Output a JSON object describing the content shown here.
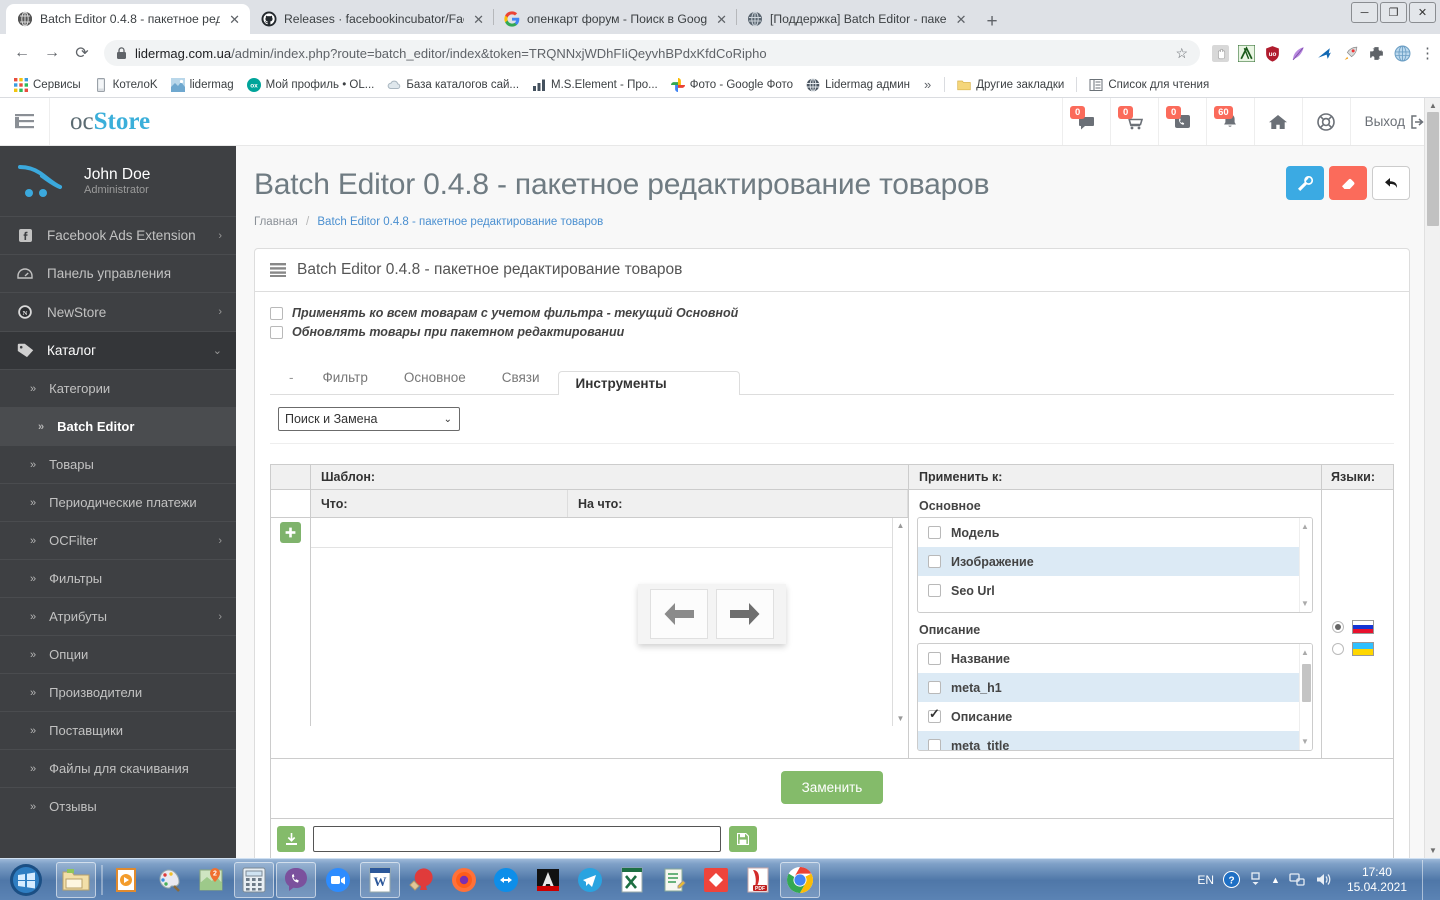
{
  "browser": {
    "tabs": [
      {
        "title": "Batch Editor 0.4.8 - пакетное ред",
        "icon": "globe-blue",
        "active": true
      },
      {
        "title": "Releases · facebookincubator/Fac",
        "icon": "github",
        "active": false
      },
      {
        "title": "опенкарт форум - Поиск в Goog",
        "icon": "google",
        "active": false
      },
      {
        "title": "[Поддержка] Batch Editor - паке",
        "icon": "globe-grey",
        "active": false
      }
    ],
    "new_tab_label": "+",
    "window_controls": {
      "minimize": "─",
      "maximize": "❐",
      "close": "✕"
    },
    "nav": {
      "back": "←",
      "forward": "→",
      "reload": "⟳"
    },
    "url_host": "lidermag.com.ua",
    "url_path": "/admin/index.php?route=batch_editor/index&token=TRQNNxjWDhFIiQeyvhBPdxKfdCoRipho",
    "star_icon": "☆",
    "extension_icons": [
      "hand-icon",
      "xmarks-icon",
      "ublock-icon",
      "feather-icon",
      "arrow-blue-icon",
      "rocket-icon",
      "puzzle-icon",
      "globe-icon"
    ],
    "menu_icon": "kebab-menu-icon",
    "bookmarks": [
      {
        "label": "Сервисы",
        "icon": "apps-grid-icon"
      },
      {
        "label": "КотелоK",
        "icon": "phone-icon"
      },
      {
        "label": "lidermag",
        "icon": "site-icon"
      },
      {
        "label": "Мой профиль • OL...",
        "icon": "olx-icon"
      },
      {
        "label": "База каталогов сай...",
        "icon": "cloud-icon"
      },
      {
        "label": "M.S.Element - Про...",
        "icon": "chart-icon"
      },
      {
        "label": "Фото - Google Фото",
        "icon": "google-photos-icon"
      },
      {
        "label": "Lidermag админ",
        "icon": "globe-blue-icon"
      }
    ],
    "bookmarks_overflow": "»",
    "other_bookmarks": "Другие закладки",
    "reading_list": "Список для чтения"
  },
  "admin": {
    "menu_toggle_icon": "hamburger-icon",
    "logo_prefix": "oc",
    "logo_suffix": "Store",
    "header_icons": [
      {
        "name": "chat-icon",
        "glyph": "💬",
        "badge": "0"
      },
      {
        "name": "cart-icon",
        "glyph": "🛒",
        "badge": "0"
      },
      {
        "name": "phone-icon",
        "glyph": "📞",
        "badge": "0"
      },
      {
        "name": "bell-icon",
        "glyph": "🔔",
        "badge": "60"
      },
      {
        "name": "home-icon",
        "glyph": "🏠",
        "badge": ""
      },
      {
        "name": "lifebuoy-icon",
        "glyph": "◎",
        "badge": ""
      }
    ],
    "logout_label": "Выход",
    "logout_icon": "logout-icon",
    "user": {
      "name": "John Doe",
      "role": "Administrator"
    },
    "sidebar": [
      {
        "label": "Facebook Ads Extension",
        "icon": "facebook-icon",
        "chevron": "›",
        "level": 0
      },
      {
        "label": "Панель управления",
        "icon": "dashboard-icon",
        "chevron": "",
        "level": 0
      },
      {
        "label": "NewStore",
        "icon": "newstore-icon",
        "chevron": "›",
        "level": 0
      },
      {
        "label": "Каталог",
        "icon": "tag-icon",
        "chevron": "⌄",
        "level": 0,
        "active": true
      },
      {
        "label": "Категории",
        "icon": "",
        "chevron": "",
        "level": 1
      },
      {
        "label": "Batch Editor",
        "icon": "",
        "chevron": "",
        "level": 1,
        "selected": true
      },
      {
        "label": "Товары",
        "icon": "",
        "chevron": "",
        "level": 1
      },
      {
        "label": "Периодические платежи",
        "icon": "",
        "chevron": "",
        "level": 1
      },
      {
        "label": "OCFilter",
        "icon": "",
        "chevron": "›",
        "level": 1
      },
      {
        "label": "Фильтры",
        "icon": "",
        "chevron": "",
        "level": 1
      },
      {
        "label": "Атрибуты",
        "icon": "",
        "chevron": "›",
        "level": 1
      },
      {
        "label": "Опции",
        "icon": "",
        "chevron": "",
        "level": 1
      },
      {
        "label": "Производители",
        "icon": "",
        "chevron": "",
        "level": 1
      },
      {
        "label": "Поставщики",
        "icon": "",
        "chevron": "",
        "level": 1
      },
      {
        "label": "Файлы для скачивания",
        "icon": "",
        "chevron": "",
        "level": 1
      },
      {
        "label": "Отзывы",
        "icon": "",
        "chevron": "",
        "level": 1
      }
    ],
    "page_title": "Batch Editor 0.4.8 - пакетное редактирование товаров",
    "breadcrumb": {
      "home": "Главная",
      "separator": "/",
      "current": "Batch Editor 0.4.8 - пакетное редактирование товаров"
    },
    "head_actions": [
      {
        "name": "settings-wrench-button",
        "glyph": "🔧",
        "color": "#3baae3"
      },
      {
        "name": "clear-eraser-button",
        "glyph": "▰",
        "color": "#fb6b5b"
      },
      {
        "name": "back-button",
        "glyph": "↩",
        "color": "#ffffff"
      }
    ],
    "panel_title": "Batch Editor 0.4.8 - пакетное редактирование товаров",
    "panel_icon": "list-icon",
    "options": [
      {
        "label": "Применять ко всем товарам с учетом фильтра - текущий Основной",
        "checked": false
      },
      {
        "label": "Обновлять товары при пакетном редактировании",
        "checked": false
      }
    ],
    "tabs": [
      {
        "label": "-",
        "selected": false
      },
      {
        "label": "Фильтр",
        "selected": false
      },
      {
        "label": "Основное",
        "selected": false
      },
      {
        "label": "Связи",
        "selected": false
      },
      {
        "label": "Инструменты",
        "selected": true
      }
    ],
    "tool_select": {
      "value": "Поиск и Замена",
      "chevron": "⌄"
    },
    "grid": {
      "template_label": "Шаблон:",
      "col_what": "Что:",
      "col_to": "На что:",
      "add_button_icon": "plus-icon",
      "scroll_up": "▲",
      "scroll_down": "▼"
    },
    "overlay": {
      "left_arrow": "left-arrow-icon",
      "right_arrow": "right-arrow-icon"
    },
    "apply_to": {
      "header": "Применить к:",
      "groups": [
        {
          "label": "Основное",
          "items": [
            {
              "label": "Модель",
              "checked": false
            },
            {
              "label": "Изображение",
              "checked": false
            },
            {
              "label": "Seo Url",
              "checked": false
            }
          ]
        },
        {
          "label": "Описание",
          "items": [
            {
              "label": "Название",
              "checked": false
            },
            {
              "label": "meta_h1",
              "checked": false
            },
            {
              "label": "Описание",
              "checked": true
            },
            {
              "label": "meta_title",
              "checked": false
            }
          ]
        }
      ]
    },
    "languages": {
      "header": "Языки:",
      "items": [
        {
          "name": "russian-flag",
          "selected": true,
          "colors": [
            "#ffffff",
            "#1435d4",
            "#e8112d"
          ]
        },
        {
          "name": "ukrainian-flag",
          "selected": false,
          "colors": [
            "#2fc0ff",
            "#2fc0ff",
            "#ffd700"
          ]
        }
      ]
    },
    "replace_button": "Заменить",
    "footer": {
      "download_icon": "download-icon",
      "input_value": "",
      "save_icon": "save-icon"
    }
  },
  "taskbar": {
    "start_icon": "windows-start-orb",
    "apps": [
      {
        "name": "explorer-icon",
        "glyph": "🗂",
        "framed": true
      },
      {
        "name": "media-player-icon",
        "glyph": "▶",
        "framed": false
      },
      {
        "name": "paint-icon",
        "glyph": "🎨",
        "framed": false
      },
      {
        "name": "maps-icon",
        "glyph": "🗺",
        "framed": false
      },
      {
        "name": "calculator-icon",
        "glyph": "🖩",
        "framed": true
      },
      {
        "name": "viber-icon",
        "glyph": "📞",
        "framed": true
      },
      {
        "name": "zoom-icon",
        "glyph": "📹",
        "framed": false
      },
      {
        "name": "word-icon",
        "glyph": "W",
        "framed": true
      },
      {
        "name": "ccleaner-icon",
        "glyph": "🧹",
        "framed": false
      },
      {
        "name": "firefox-icon",
        "glyph": "🦊",
        "framed": false
      },
      {
        "name": "teamviewer-icon",
        "glyph": "⬌",
        "framed": false
      },
      {
        "name": "autocad-icon",
        "glyph": "A",
        "framed": false
      },
      {
        "name": "telegram-icon",
        "glyph": "✈",
        "framed": false
      },
      {
        "name": "excel-icon",
        "glyph": "X",
        "framed": false
      },
      {
        "name": "notepad-icon",
        "glyph": "📝",
        "framed": false
      },
      {
        "name": "anydesk-icon",
        "glyph": "◆",
        "framed": false
      },
      {
        "name": "pdf-icon",
        "glyph": "PDF",
        "framed": false
      },
      {
        "name": "chrome-icon",
        "glyph": "◍",
        "framed": true
      }
    ],
    "tray": {
      "language": "EN",
      "help_icon": "help-icon",
      "expand_icon": "▲",
      "network_icon": "network-icon",
      "volume_icon": "volume-icon",
      "time": "17:40",
      "date": "15.04.2021"
    }
  }
}
